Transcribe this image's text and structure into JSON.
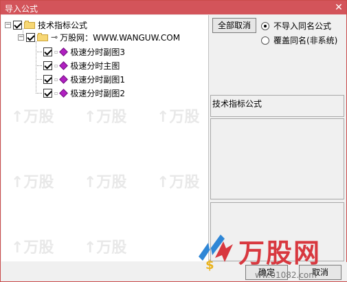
{
  "window": {
    "title": "导入公式",
    "close_glyph": "✕"
  },
  "tree": {
    "root": {
      "label": "技术指标公式",
      "expander": "−"
    },
    "group": {
      "label": "万股网：WWW.WANGUW.COM",
      "expander": "−"
    },
    "items": [
      {
        "label": "极速分时副图3"
      },
      {
        "label": "极速分时主图"
      },
      {
        "label": "极速分时副图1"
      },
      {
        "label": "极速分时副图2"
      }
    ]
  },
  "options": {
    "cancel_all_label": "全部取消",
    "radio_no_import": "不导入同名公式",
    "radio_overwrite": "覆盖同名(非系统)",
    "selected": "no_import"
  },
  "info": {
    "category_label": "技术指标公式"
  },
  "footer": {
    "ok_label": "确定",
    "cancel_label": "取消"
  },
  "watermark": {
    "brand": "万股网",
    "site": "ww.01082.com",
    "colors": {
      "brand_red": "#d8383f"
    }
  }
}
